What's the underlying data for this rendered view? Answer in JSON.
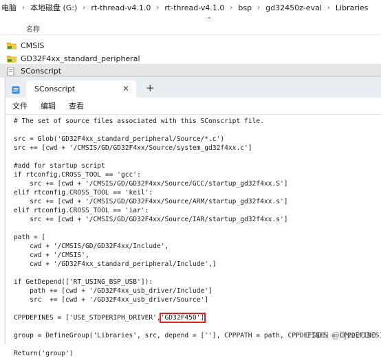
{
  "breadcrumb": [
    "电脑",
    "本地磁盘 (G:)",
    "rt-thread-v4.1.0",
    "rt-thread-v4.1.0",
    "bsp",
    "gd32450z-eval",
    "Libraries"
  ],
  "explorer": {
    "column_header": "名称",
    "items": [
      {
        "name": "CMSIS",
        "icon": "folder-icon"
      },
      {
        "name": "GD32F4xx_standard_peripheral",
        "icon": "folder-icon"
      },
      {
        "name": "SConscript",
        "icon": "file-icon",
        "selected": true
      }
    ]
  },
  "notepad": {
    "tab_title": "SConscript",
    "add_tab": "+",
    "close_tab": "✕",
    "menu": [
      "文件",
      "编辑",
      "查看"
    ],
    "code_lines": [
      "# The set of source files associated with this SConscript file.",
      "",
      "src = Glob('GD32F4xx_standard_peripheral/Source/*.c')",
      "src += [cwd + '/CMSIS/GD/GD32F4xx/Source/system_gd32f4xx.c']",
      "",
      "#add for startup script",
      "if rtconfig.CROSS_TOOL == 'gcc':",
      "    src += [cwd + '/CMSIS/GD/GD32F4xx/Source/GCC/startup_gd32f4xx.S']",
      "elif rtconfig.CROSS_TOOL == 'keil':",
      "    src += [cwd + '/CMSIS/GD/GD32F4xx/Source/ARM/startup_gd32f4xx.s']",
      "elif rtconfig.CROSS_TOOL == 'iar':",
      "    src += [cwd + '/CMSIS/GD/GD32F4xx/Source/IAR/startup_gd32f4xx.s']",
      "",
      "path = [",
      "    cwd + '/CMSIS/GD/GD32F4xx/Include',",
      "    cwd + '/CMSIS',",
      "    cwd + '/GD32F4xx_standard_peripheral/Include',]",
      "",
      "if GetDepend(['RT_USING_BSP_USB']):",
      "    path += [cwd + '/GD32F4xx_usb_driver/Include']",
      "    src  += [cwd + '/GD32F4xx_usb_driver/Source']",
      "",
      "CPPDEFINES = ['USE_STDPERIPH_DRIVER',",
      "",
      "group = DefineGroup('Libraries', src, depend = [''], CPPPATH = path, CPPDEFINES = CPPDEFINES)",
      "",
      "Return('group')"
    ],
    "highlighted_token": "'GD32F450']",
    "highlight_color": "#e02020"
  },
  "watermark": "CSDN @lljss2020"
}
